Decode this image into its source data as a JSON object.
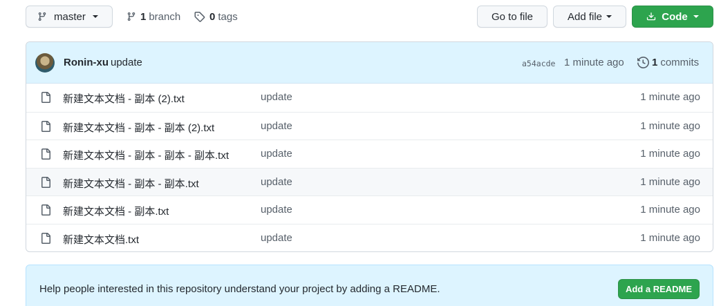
{
  "toolbar": {
    "branch_name": "master",
    "branches_count": "1",
    "branches_label": "branch",
    "tags_count": "0",
    "tags_label": "tags",
    "goto_file_label": "Go to file",
    "add_file_label": "Add file",
    "code_label": "Code"
  },
  "latest_commit": {
    "author": "Ronin-xu",
    "message": "update",
    "sha": "a54acde",
    "age": "1 minute ago",
    "commits_count": "1",
    "commits_label": "commits"
  },
  "files": [
    {
      "name": "新建文本文档 - 副本 (2).txt",
      "message": "update",
      "age": "1 minute ago"
    },
    {
      "name": "新建文本文档 - 副本 - 副本 (2).txt",
      "message": "update",
      "age": "1 minute ago"
    },
    {
      "name": "新建文本文档 - 副本 - 副本 - 副本.txt",
      "message": "update",
      "age": "1 minute ago"
    },
    {
      "name": "新建文本文档 - 副本 - 副本.txt",
      "message": "update",
      "age": "1 minute ago"
    },
    {
      "name": "新建文本文档 - 副本.txt",
      "message": "update",
      "age": "1 minute ago"
    },
    {
      "name": "新建文本文档.txt",
      "message": "update",
      "age": "1 minute ago"
    }
  ],
  "readme": {
    "prompt": "Help people interested in this repository understand your project by adding a README.",
    "button_label": "Add a README"
  },
  "colors": {
    "primary_green": "#2da44e",
    "banner_blue": "#ddf4ff",
    "muted_text": "#57606a"
  },
  "icons": {
    "branch": "git-branch-icon",
    "tag": "tag-icon",
    "download": "download-icon",
    "history": "history-icon",
    "file": "file-icon"
  }
}
